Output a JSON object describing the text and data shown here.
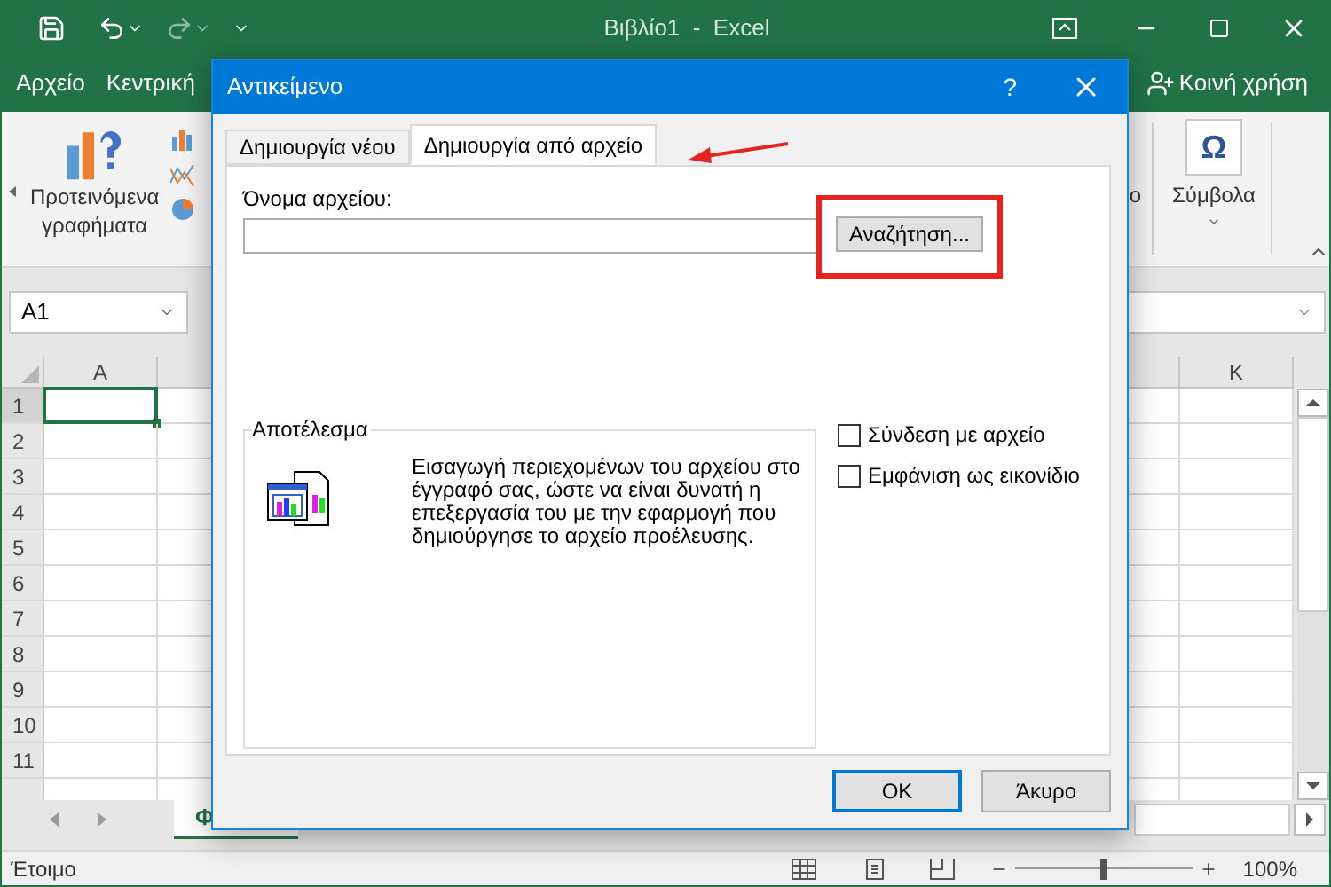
{
  "app_window": {
    "title": "Βιβλίο1  -  Excel"
  },
  "ribbon_tabs": [
    {
      "label": "Αρχείο"
    },
    {
      "label": "Κεντρική"
    }
  ],
  "share": "Κοινή χρήση",
  "ribbon": {
    "recommended_charts": [
      "Προτεινόμενα",
      "γραφήματα"
    ],
    "cut_label": "ο",
    "symbol_glyph": "Ω",
    "symbols": "Σύμβολα"
  },
  "name_box": {
    "value": "A1"
  },
  "sheet": {
    "columns_left": [
      "A"
    ],
    "columns_right": [
      "K"
    ],
    "rows": [
      {
        "label": "1",
        "selected": true
      },
      {
        "label": "2",
        "selected": false
      },
      {
        "label": "3",
        "selected": false
      },
      {
        "label": "4",
        "selected": false
      },
      {
        "label": "5",
        "selected": false
      },
      {
        "label": "6",
        "selected": false
      },
      {
        "label": "7",
        "selected": false
      },
      {
        "label": "8",
        "selected": false
      },
      {
        "label": "9",
        "selected": false
      },
      {
        "label": "10",
        "selected": false
      },
      {
        "label": "11",
        "selected": false
      }
    ],
    "sheet_tab": "Φ"
  },
  "status_bar": {
    "text": "Έτοιμο",
    "zoom": "100%",
    "zoom_slider": {
      "level": 0.5
    }
  },
  "dialog": {
    "title": "Αντικείμενο",
    "help": "?",
    "tabs": [
      {
        "label": "Δημιουργία νέου",
        "selected": false
      },
      {
        "label": "Δημιουργία από αρχείο",
        "selected": true
      }
    ],
    "file_name_label": "Όνομα αρχείου:",
    "browse_button": "Αναζήτηση...",
    "options": [
      {
        "label": "Σύνδεση με αρχείο",
        "checked": false
      },
      {
        "label": "Εμφάνιση ως εικονίδιο",
        "checked": false
      }
    ],
    "result": {
      "title": "Αποτέλεσμα",
      "text": "Εισαγωγή περιεχομένων του αρχείου στο έγγραφό σας, ώστε να είναι δυνατή η επεξεργασία του με την εφαρμογή που δημιούργησε το αρχείο προέλευσης."
    },
    "buttons": [
      {
        "label": "OK",
        "default": true
      },
      {
        "label": "Άκυρο",
        "default": false
      }
    ]
  }
}
